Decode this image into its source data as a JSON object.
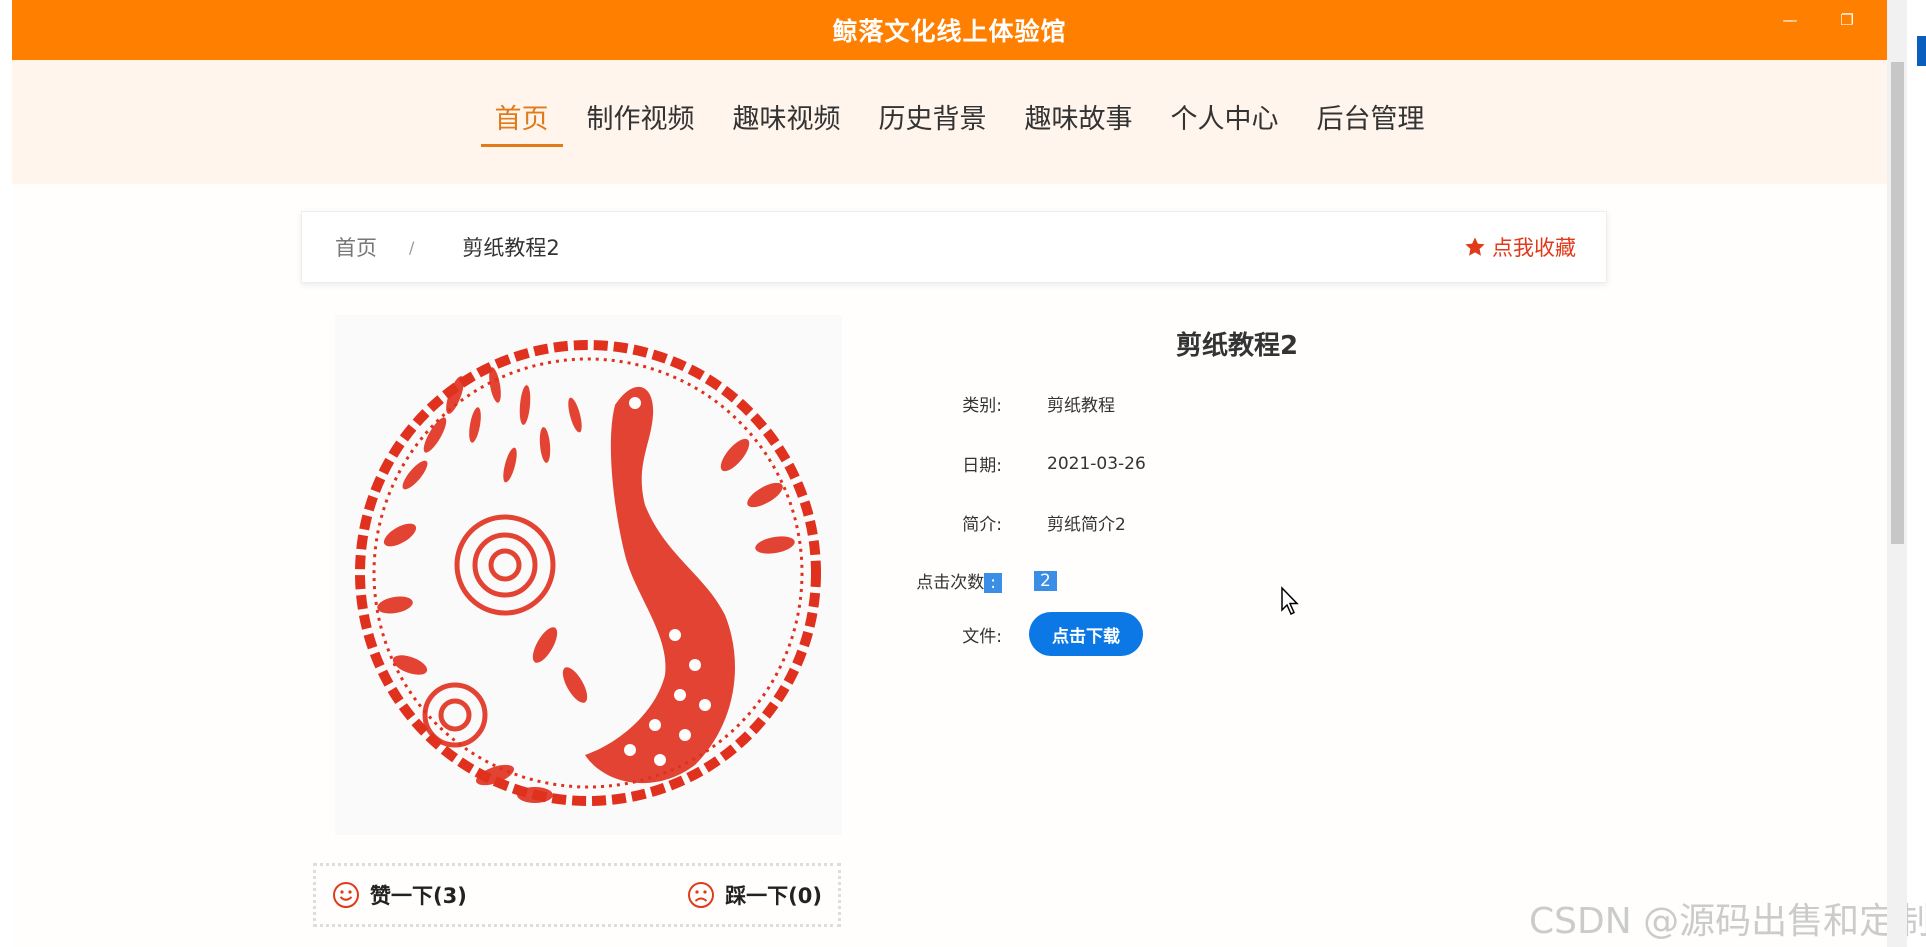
{
  "window": {
    "title": "鲸落文化线上体验馆",
    "controls": [
      "minimize",
      "maximize",
      "close"
    ]
  },
  "nav": {
    "items": [
      {
        "label": "首页",
        "active": true
      },
      {
        "label": "制作视频",
        "active": false
      },
      {
        "label": "趣味视频",
        "active": false
      },
      {
        "label": "历史背景",
        "active": false
      },
      {
        "label": "趣味故事",
        "active": false
      },
      {
        "label": "个人中心",
        "active": false
      },
      {
        "label": "后台管理",
        "active": false
      }
    ]
  },
  "breadcrumb": {
    "home": "首页",
    "separator": "/",
    "current": "剪纸教程2",
    "favorite_label": "点我收藏"
  },
  "detail": {
    "title": "剪纸教程2",
    "category_label": "类别:",
    "category_value": "剪纸教程",
    "date_label": "日期:",
    "date_value": "2021-03-26",
    "intro_label": "简介:",
    "intro_value": "剪纸简介2",
    "clicks_label_text": "点击次数",
    "clicks_label_colon": ":",
    "clicks_value": "2",
    "file_label": "文件:",
    "download_label": "点击下载"
  },
  "votes": {
    "like_label": "赞一下(3)",
    "dislike_label": "踩一下(0)"
  },
  "watermark": "CSDN @源码出售和定制",
  "colors": {
    "title_bar": "#ff7f00",
    "nav_background": "#fff5ec",
    "nav_active": "#e07a1a",
    "favorite": "#e03a1a",
    "download_button": "#0b78e6",
    "papercut": "#e0301e"
  },
  "icons": {
    "favorite": "star-icon",
    "like": "smile-icon",
    "dislike": "frown-icon"
  }
}
